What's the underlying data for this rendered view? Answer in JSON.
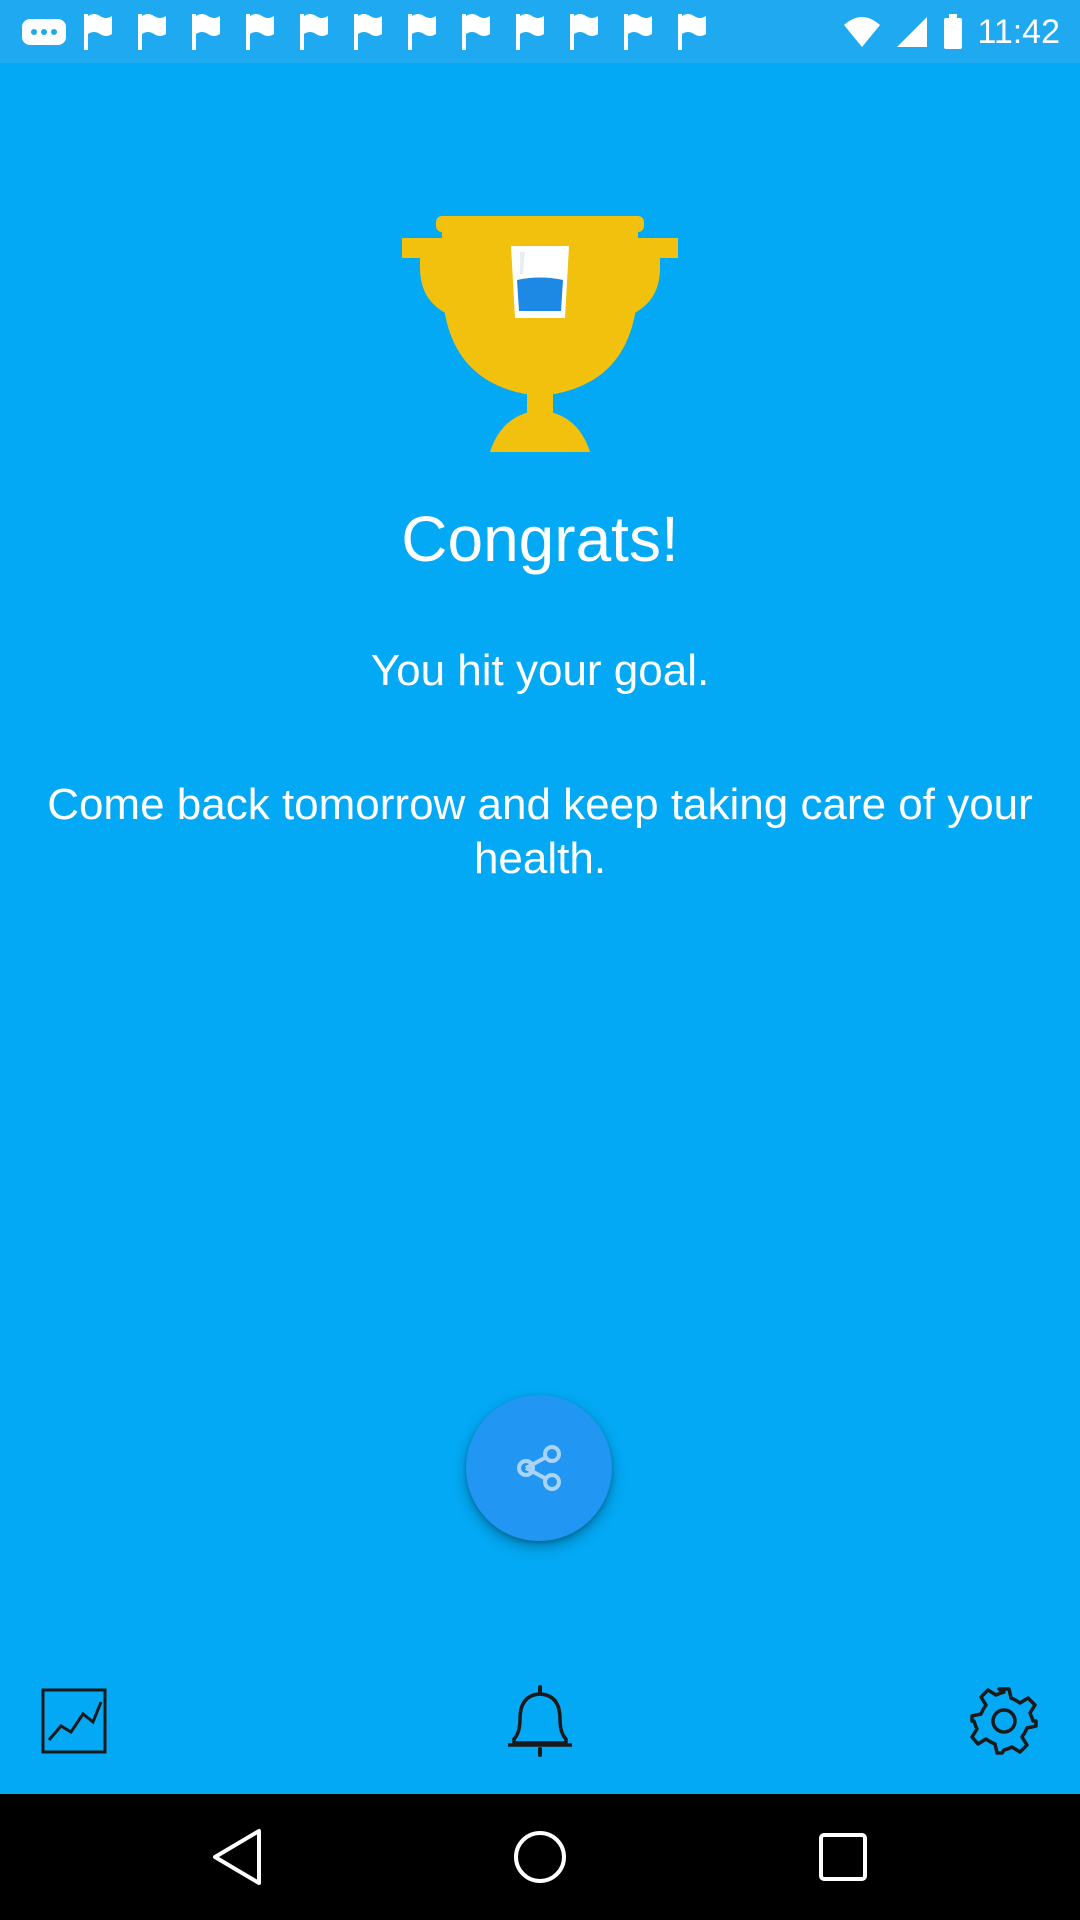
{
  "status_bar": {
    "time": "11:42",
    "icons": [
      "more-dots-icon",
      "flag-icon",
      "flag-icon",
      "flag-icon",
      "flag-icon",
      "flag-icon",
      "flag-icon",
      "flag-icon",
      "flag-icon",
      "flag-icon",
      "flag-icon",
      "flag-icon",
      "flag-icon",
      "wifi-icon",
      "signal-icon",
      "battery-icon"
    ]
  },
  "main": {
    "title": "Congrats!",
    "subtitle": "You hit your goal.",
    "message": "Come back tomorrow and keep taking care of your health."
  },
  "actions": {
    "share": "share-icon",
    "stats": "chart-icon",
    "reminder": "bell-icon",
    "settings": "gear-icon"
  },
  "colors": {
    "background": "#03A9F4",
    "fab": "#2196F3",
    "trophy": "#F2C10E",
    "water": "#1E88E5"
  }
}
